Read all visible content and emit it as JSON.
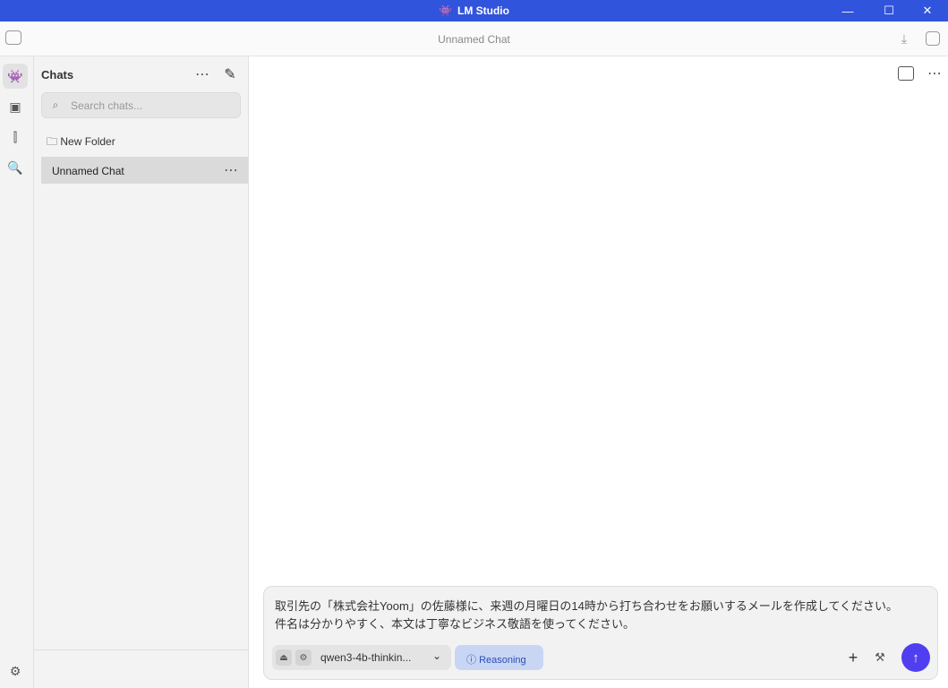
{
  "app": {
    "title": "LM Studio"
  },
  "header": {
    "title": "Unnamed Chat"
  },
  "sidebar": {
    "heading": "Chats",
    "search_placeholder": "Search chats...",
    "new_folder": "New Folder",
    "chats": [
      {
        "label": "Unnamed Chat"
      }
    ]
  },
  "composer": {
    "line1": "取引先の「株式会社Yoom」の佐藤様に、来週の月曜日の14時から打ち合わせをお願いするメールを作成してください。",
    "line2": "件名は分かりやすく、本文は丁寧なビジネス敬語を使ってください。",
    "model": "qwen3-4b-thinkin...",
    "reasoning": "Reasoning"
  },
  "colors": {
    "accent": "#4f3ff0",
    "titlebar": "#3154dc"
  }
}
